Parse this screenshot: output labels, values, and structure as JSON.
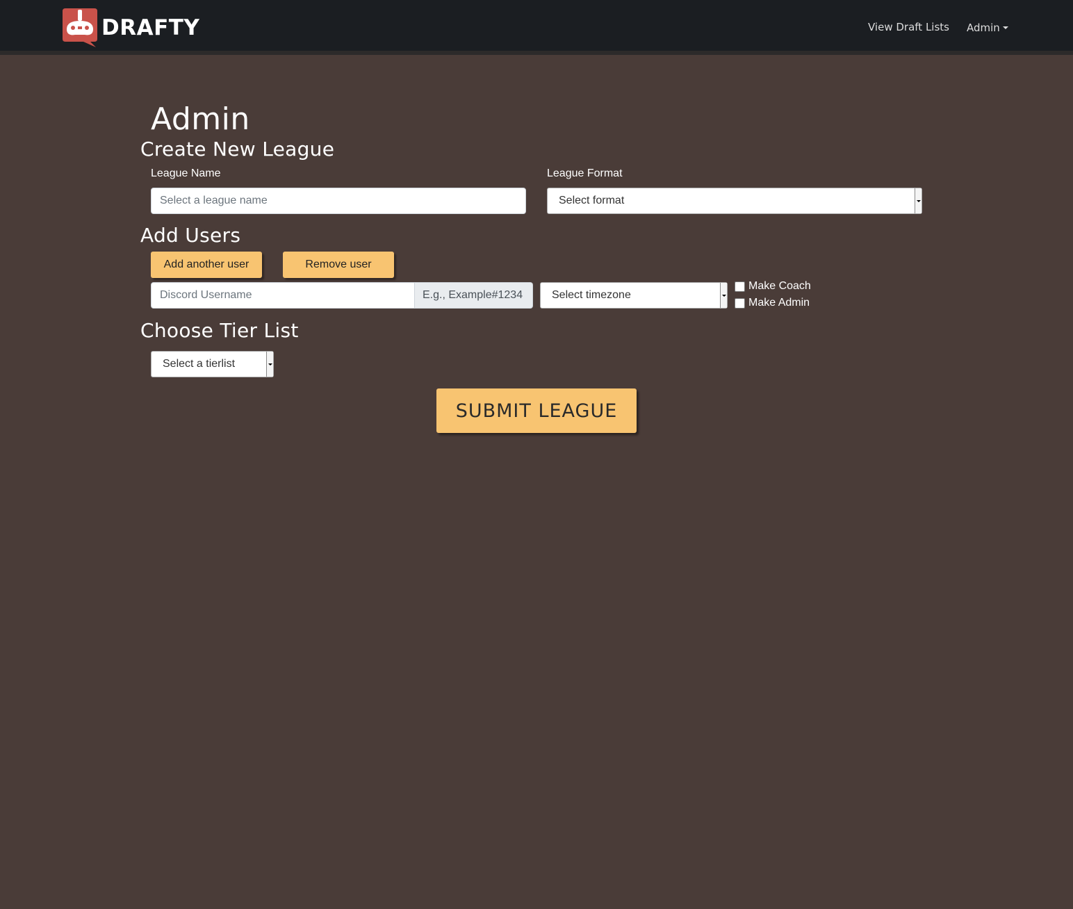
{
  "navbar": {
    "brand": "DRAFTY",
    "links": {
      "view_draft_lists": "View Draft Lists",
      "admin": "Admin"
    }
  },
  "page": {
    "title": "Admin"
  },
  "create_league": {
    "heading": "Create New League",
    "league_name_label": "League Name",
    "league_name_placeholder": "Select a league name",
    "league_format_label": "League Format",
    "league_format_value": "Select format"
  },
  "add_users": {
    "heading": "Add Users",
    "add_button": "Add another user",
    "remove_button": "Remove user",
    "discord_placeholder": "Discord Username",
    "discord_addon": "E.g., Example#1234",
    "timezone_value": "Select timezone",
    "make_coach": "Make Coach",
    "make_admin": "Make Admin"
  },
  "tier_list": {
    "heading": "Choose Tier List",
    "select_value": "Select a tierlist"
  },
  "submit": {
    "label": "SUBMIT LEAGUE"
  },
  "colors": {
    "background": "#4a3c38",
    "navbar": "#1b1e22",
    "accent": "#f8c471",
    "logo": "#c9524a"
  }
}
